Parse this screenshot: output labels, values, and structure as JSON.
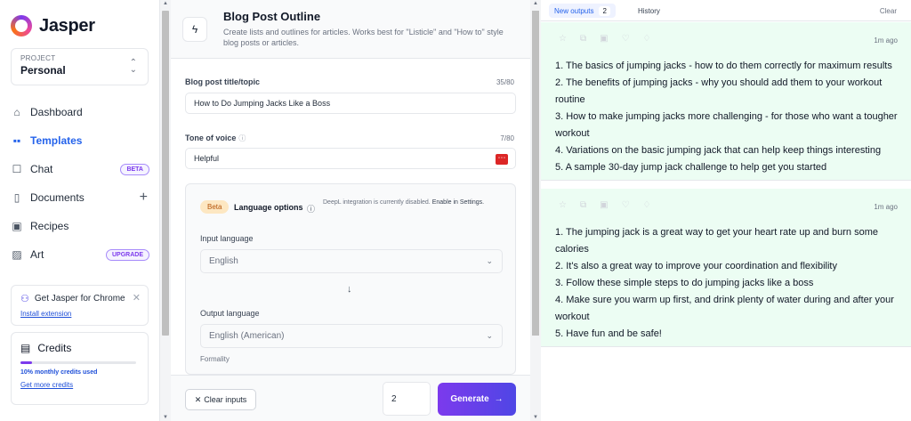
{
  "brand": {
    "name": "Jasper"
  },
  "project": {
    "label": "PROJECT",
    "name": "Personal"
  },
  "nav": [
    {
      "label": "Dashboard",
      "icon": "home-icon"
    },
    {
      "label": "Templates",
      "icon": "grid-icon"
    },
    {
      "label": "Chat",
      "icon": "chat-icon",
      "badge": "BETA"
    },
    {
      "label": "Documents",
      "icon": "document-icon"
    },
    {
      "label": "Recipes",
      "icon": "terminal-icon"
    },
    {
      "label": "Art",
      "icon": "image-icon",
      "badge": "UPGRADE"
    }
  ],
  "chrome_card": {
    "title": "Get Jasper for Chrome",
    "link": "Install extension"
  },
  "credits": {
    "title": "Credits",
    "used_text": "10% monthly credits used",
    "used_fraction": 0.1,
    "link": "Get more credits"
  },
  "template": {
    "title": "Blog Post Outline",
    "description": "Create lists and outlines for articles. Works best for \"Listicle\" and \"How to\" style blog posts or articles."
  },
  "form": {
    "title_label": "Blog post title/topic",
    "title_count": "35/80",
    "title_value": "How to Do Jumping Jacks Like a Boss",
    "tone_label": "Tone of voice",
    "tone_count": "7/80",
    "tone_value": "Helpful"
  },
  "language": {
    "beta": "Beta",
    "title": "Language options",
    "note_normal": "DeepL integration is currently disabled.",
    "note_strong": "Enable in Settings.",
    "input_label": "Input language",
    "input_value": "English",
    "output_label": "Output language",
    "output_value": "English (American)",
    "formality_label": "Formality"
  },
  "footer": {
    "clear": "Clear inputs",
    "count": "2",
    "generate": "Generate"
  },
  "outputs_header": {
    "new_label": "New outputs",
    "new_count": "2",
    "history": "History",
    "clear": "Clear"
  },
  "outputs": [
    {
      "time": "1m ago",
      "lines": [
        "1. The basics of jumping jacks - how to do them correctly for maximum results",
        "2. The benefits of jumping jacks - why you should add them to your workout routine",
        "3. How to make jumping jacks more challenging - for those who want a tougher workout",
        "4. Variations on the basic jumping jack that can help keep things interesting",
        "5. A sample 30-day jump jack challenge to help get you started"
      ]
    },
    {
      "time": "1m ago",
      "lines": [
        "1. The jumping jack is a great way to get your heart rate up and burn some calories",
        "2. It's also a great way to improve your coordination and flexibility",
        "3. Follow these simple steps to do jumping jacks like a boss",
        "4. Make sure you warm up first, and drink plenty of water during and after your workout",
        "5. Have fun and be safe!"
      ]
    }
  ],
  "colors": {
    "accent": "#2563eb",
    "brand_purple": "#7c3aed",
    "output_bg": "#ecfdf3"
  }
}
